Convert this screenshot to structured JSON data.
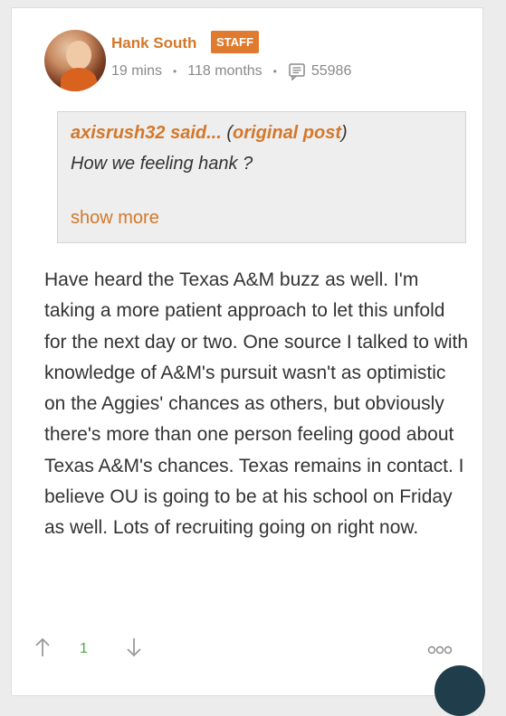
{
  "post": {
    "author": {
      "name": "Hank South",
      "badge": "STAFF"
    },
    "meta": {
      "posted": "19 mins",
      "tenure": "118 months",
      "post_count": "55986",
      "separator": "•"
    },
    "quote": {
      "user": "axisrush32",
      "said": "said...",
      "open_paren": "(",
      "link": "original post",
      "close_paren": ")",
      "text": "How we feeling hank ?",
      "show_more": "show more"
    },
    "body": "Have heard the Texas A&M buzz as well. I'm taking a more patient approach to let this unfold for the next day or two. One source I talked to with knowledge of A&M's pursuit wasn't as optimistic on the Aggies' chances as others, but obviously there's more than one person feeling good about Texas A&M's chances. Texas remains in contact. I believe OU is going to be at his school on Friday as well. Lots of recruiting going on right now.",
    "votes": {
      "count": "1"
    }
  },
  "colors": {
    "accent": "#d3782b",
    "badge_bg": "#e07a2e",
    "vote_count": "#4aa84a",
    "fab": "#1f3d4a"
  },
  "icons": {
    "posts": "message-lines-icon",
    "upvote": "arrow-up-icon",
    "downvote": "arrow-down-icon",
    "more": "ellipsis-icon"
  }
}
